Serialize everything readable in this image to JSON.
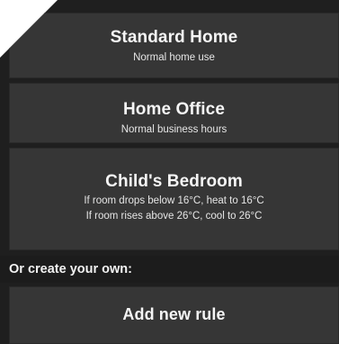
{
  "rules": [
    {
      "title": "Standard Home",
      "subtitle_lines": [
        "Normal home use"
      ]
    },
    {
      "title": "Home Office",
      "subtitle_lines": [
        "Normal business hours"
      ]
    },
    {
      "title": "Child's Bedroom",
      "subtitle_lines": [
        "If room drops below 16°C, heat to 16°C",
        "If room rises above 26°C, cool to 26°C"
      ]
    }
  ],
  "create_section": {
    "header": "Or create your own:",
    "add_button_label": "Add new rule"
  },
  "colors": {
    "background": "#1f1f1f",
    "card": "#363636",
    "header_bar": "#1c1c1c",
    "text": "#f2f2f2"
  }
}
